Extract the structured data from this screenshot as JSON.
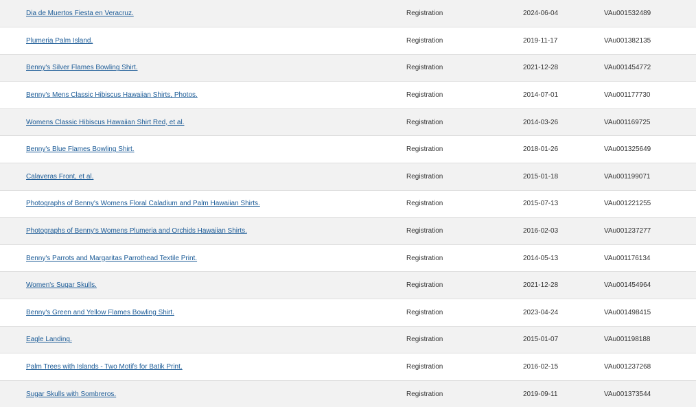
{
  "results": {
    "rows": [
      {
        "title": "Dia de Muertos Fiesta en Veracruz.",
        "type": "Registration",
        "date": "2024-06-04",
        "number": "VAu001532489"
      },
      {
        "title": "Plumeria Palm Island.",
        "type": "Registration",
        "date": "2019-11-17",
        "number": "VAu001382135"
      },
      {
        "title": "Benny's Silver Flames Bowling Shirt.",
        "type": "Registration",
        "date": "2021-12-28",
        "number": "VAu001454772"
      },
      {
        "title": "Benny's Mens Classic Hibiscus Hawaiian Shirts, Photos.",
        "type": "Registration",
        "date": "2014-07-01",
        "number": "VAu001177730"
      },
      {
        "title": "Womens Classic Hibiscus Hawaiian Shirt Red, et al.",
        "type": "Registration",
        "date": "2014-03-26",
        "number": "VAu001169725"
      },
      {
        "title": "Benny's Blue Flames Bowling Shirt.",
        "type": "Registration",
        "date": "2018-01-26",
        "number": "VAu001325649"
      },
      {
        "title": "Calaveras Front, et al.",
        "type": "Registration",
        "date": "2015-01-18",
        "number": "VAu001199071"
      },
      {
        "title": "Photographs of Benny's Womens Floral Caladium and Palm Hawaiian Shirts.",
        "type": "Registration",
        "date": "2015-07-13",
        "number": "VAu001221255"
      },
      {
        "title": "Photographs of Benny's Womens Plumeria and Orchids Hawaiian Shirts.",
        "type": "Registration",
        "date": "2016-02-03",
        "number": "VAu001237277"
      },
      {
        "title": "Benny's Parrots and Margaritas Parrothead Textile Print.",
        "type": "Registration",
        "date": "2014-05-13",
        "number": "VAu001176134"
      },
      {
        "title": "Women's Sugar Skulls.",
        "type": "Registration",
        "date": "2021-12-28",
        "number": "VAu001454964"
      },
      {
        "title": "Benny's Green and Yellow Flames Bowling Shirt.",
        "type": "Registration",
        "date": "2023-04-24",
        "number": "VAu001498415"
      },
      {
        "title": "Eagle Landing.",
        "type": "Registration",
        "date": "2015-01-07",
        "number": "VAu001198188"
      },
      {
        "title": "Palm Trees with Islands - Two Motifs for Batik Print.",
        "type": "Registration",
        "date": "2016-02-15",
        "number": "VAu001237268"
      },
      {
        "title": "Sugar Skulls with Sombreros.",
        "type": "Registration",
        "date": "2019-09-11",
        "number": "VAu001373544"
      }
    ]
  },
  "colors": {
    "link": "#1a5a96",
    "row_odd": "#f2f2f2",
    "row_even": "#ffffff",
    "text": "#333333"
  }
}
